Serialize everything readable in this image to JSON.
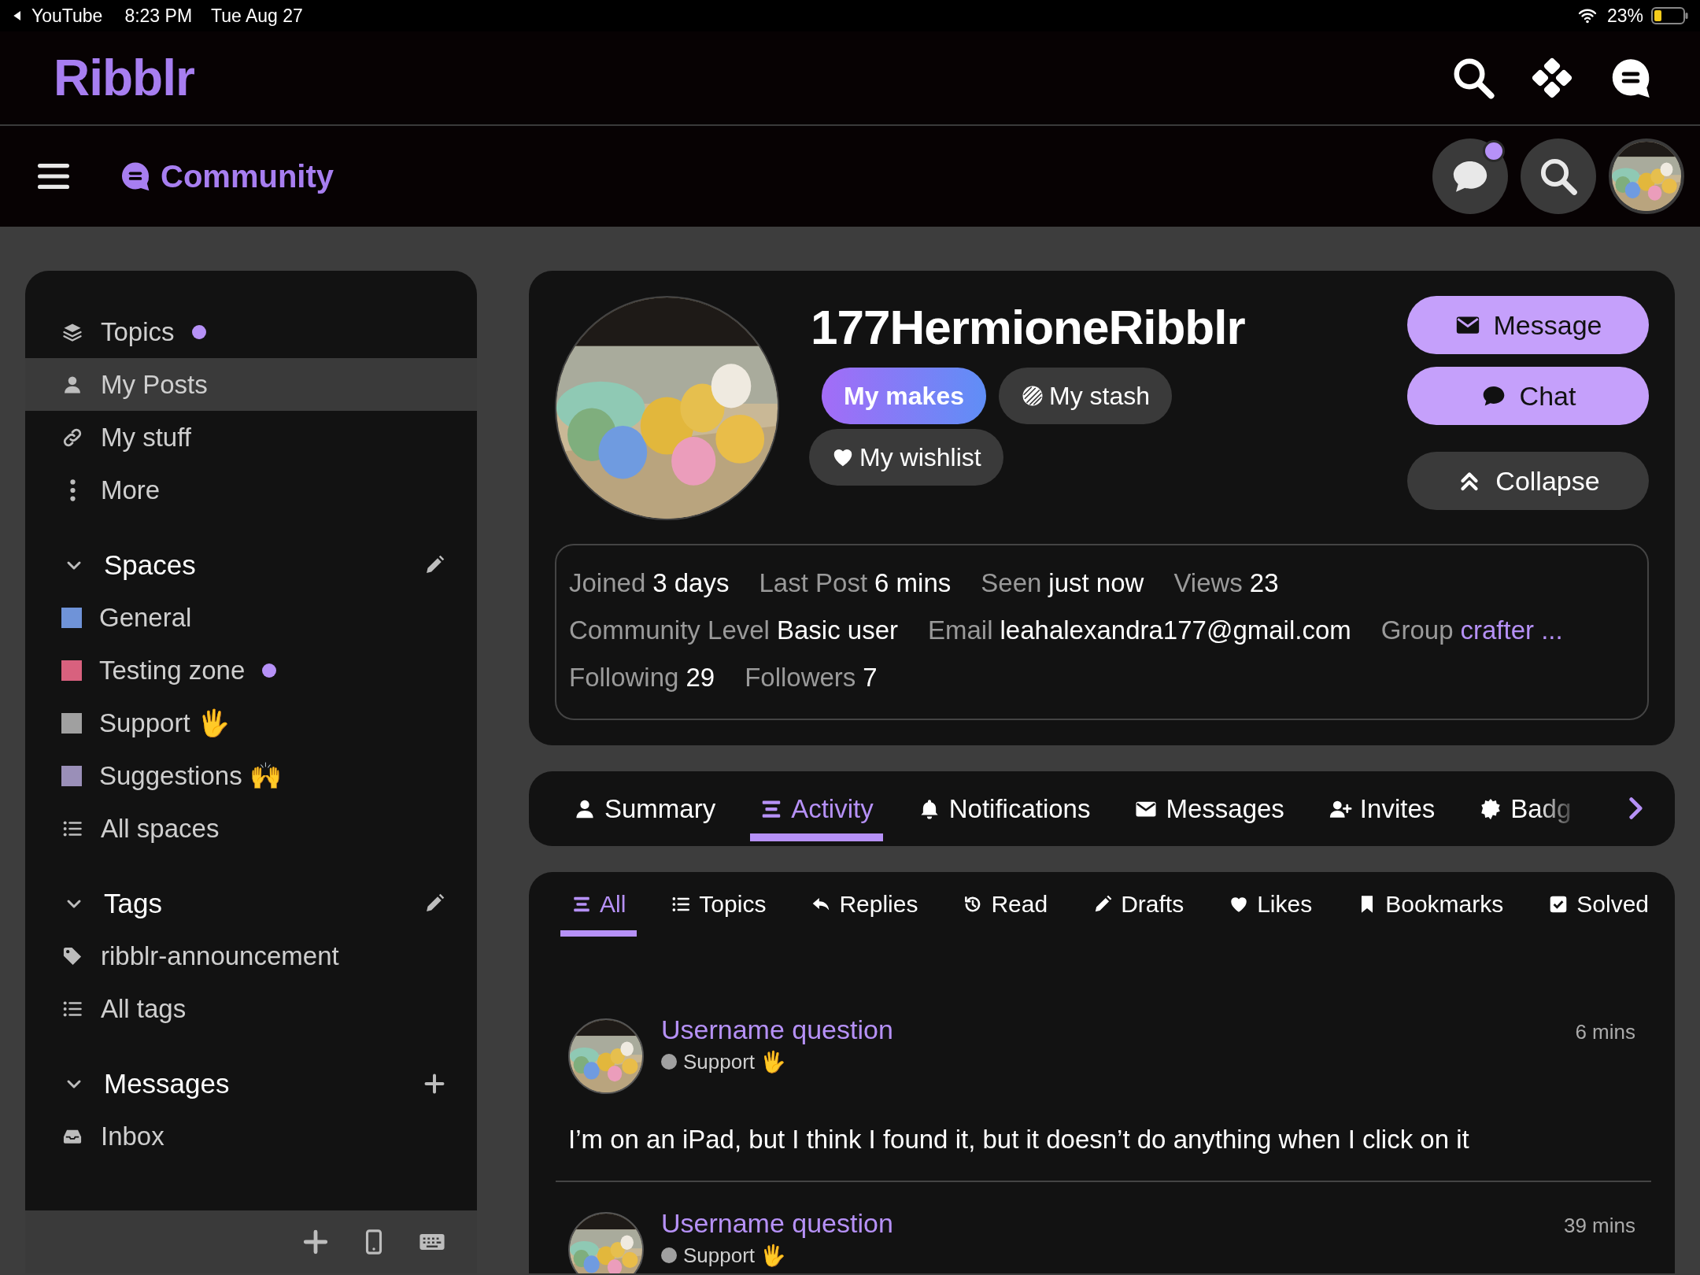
{
  "status_bar": {
    "back_label": "YouTube",
    "time": "8:23 PM",
    "date": "Tue Aug 27",
    "battery": "23%"
  },
  "header": {
    "logo": "Ribblr"
  },
  "subheader": {
    "title": "Community",
    "chat_unread": true
  },
  "sidebar": {
    "nav": [
      {
        "label": "Topics",
        "selected": false,
        "unread": true
      },
      {
        "label": "My Posts",
        "selected": true,
        "unread": false
      },
      {
        "label": "My stuff",
        "selected": false,
        "unread": false
      },
      {
        "label": "More",
        "selected": false,
        "unread": false
      }
    ],
    "sections": [
      {
        "title": "Spaces",
        "expanded": true,
        "editable": true,
        "items": [
          {
            "kind": "space",
            "label": "General",
            "color": "#6f93d8",
            "unread": false
          },
          {
            "kind": "space",
            "label": "Testing zone",
            "color": "#d8617e",
            "unread": true
          },
          {
            "kind": "space",
            "label": "Support 🖐",
            "color": "#a0a0a0",
            "unread": false
          },
          {
            "kind": "space",
            "label": "Suggestions 🙌",
            "color": "#9a8fb8",
            "unread": false
          },
          {
            "kind": "list",
            "label": "All spaces",
            "unread": false
          }
        ]
      },
      {
        "title": "Tags",
        "expanded": true,
        "editable": true,
        "items": [
          {
            "kind": "tag",
            "label": "ribblr-announcement",
            "unread": false
          },
          {
            "kind": "list",
            "label": "All tags",
            "unread": false
          }
        ]
      },
      {
        "title": "Messages",
        "expanded": true,
        "addable": true,
        "items": [
          {
            "kind": "inbox",
            "label": "Inbox",
            "unread": false
          }
        ]
      }
    ]
  },
  "profile": {
    "username": "177HermioneRibblr",
    "links": [
      {
        "label": "My makes",
        "selected": true
      },
      {
        "label": "My stash",
        "selected": false
      },
      {
        "label": "My wishlist",
        "selected": false
      }
    ],
    "actions": [
      {
        "label": "Message",
        "kind": "primary"
      },
      {
        "label": "Chat",
        "kind": "primary"
      },
      {
        "label": "Collapse",
        "kind": "secondary"
      }
    ],
    "stat_lines": [
      {
        "items": [
          {
            "label": "Joined",
            "value": "3 days",
            "kind": "text"
          },
          {
            "label": "Last Post",
            "value": "6 mins",
            "kind": "text"
          },
          {
            "label": "Seen",
            "value": "just now",
            "kind": "text"
          },
          {
            "label": "Views",
            "value": "23",
            "kind": "text"
          }
        ]
      },
      {
        "items": [
          {
            "label": "Community Level",
            "value": "Basic user",
            "kind": "text"
          },
          {
            "label": "Email",
            "value": "leahalexandra177@gmail.com",
            "kind": "text"
          },
          {
            "label": "Group",
            "value": "crafter ...",
            "kind": "link"
          }
        ]
      },
      {
        "items": [
          {
            "label": "Following",
            "value": "29",
            "kind": "text"
          },
          {
            "label": "Followers",
            "value": "7",
            "kind": "text"
          }
        ]
      }
    ]
  },
  "tabs": [
    {
      "label": "Summary",
      "selected": false
    },
    {
      "label": "Activity",
      "selected": true
    },
    {
      "label": "Notifications",
      "selected": false
    },
    {
      "label": "Messages",
      "selected": false
    },
    {
      "label": "Invites",
      "selected": false
    },
    {
      "label": "Badg",
      "selected": false
    }
  ],
  "filters": [
    {
      "label": "All",
      "selected": true
    },
    {
      "label": "Topics",
      "selected": false
    },
    {
      "label": "Replies",
      "selected": false
    },
    {
      "label": "Read",
      "selected": false
    },
    {
      "label": "Drafts",
      "selected": false
    },
    {
      "label": "Likes",
      "selected": false
    },
    {
      "label": "Bookmarks",
      "selected": false
    },
    {
      "label": "Solved",
      "selected": false
    }
  ],
  "posts": [
    {
      "title": "Username question",
      "category": "Support 🖐",
      "color": "#a0a0a0",
      "time": "6 mins",
      "excerpt": "I’m on an iPad, but I think I found it, but it doesn’t do anything when I click on it"
    },
    {
      "title": "Username question",
      "category": "Support 🖐",
      "color": "#a0a0a0",
      "time": "39 mins"
    }
  ]
}
